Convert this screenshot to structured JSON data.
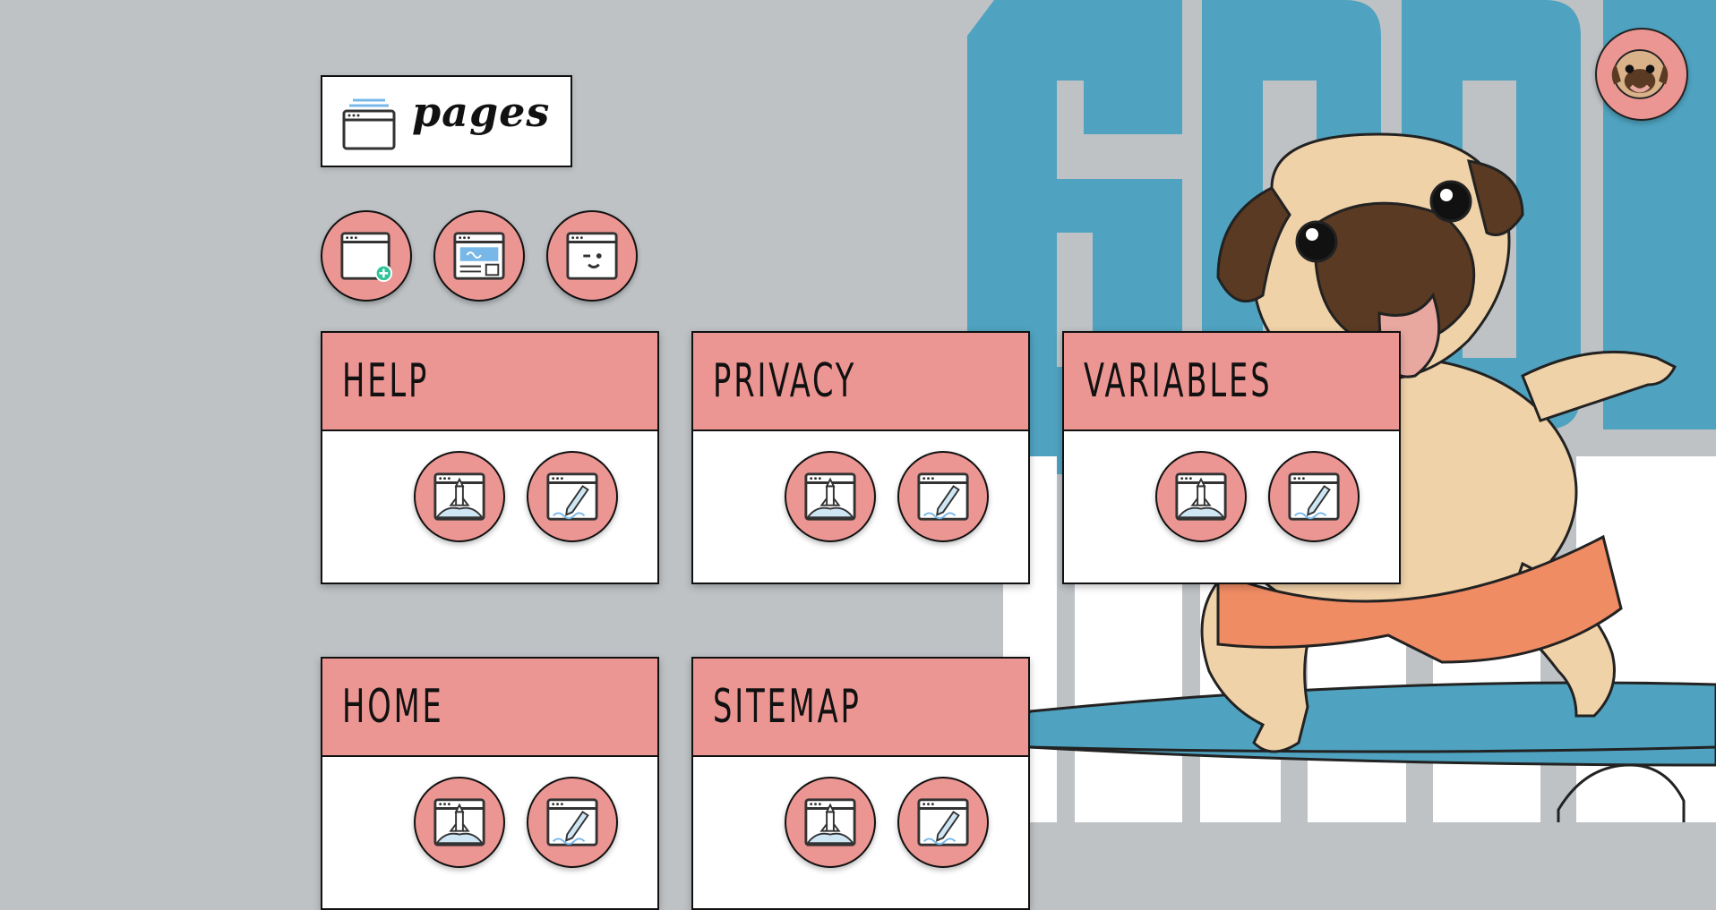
{
  "header": {
    "title": "pages",
    "icon": "browser-window-icon"
  },
  "avatar": {
    "icon": "pug-avatar-icon"
  },
  "toolbar": {
    "buttons": [
      {
        "name": "add-page-button",
        "icon": "browser-add-icon"
      },
      {
        "name": "page-layout-button",
        "icon": "browser-layout-icon"
      },
      {
        "name": "page-wink-button",
        "icon": "browser-wink-icon"
      }
    ]
  },
  "cards": [
    {
      "title": "HELP"
    },
    {
      "title": "PRIVACY"
    },
    {
      "title": "VARIABLES"
    },
    {
      "title": "HOME"
    },
    {
      "title": "SITEMAP"
    }
  ],
  "card_actions": {
    "deploy_icon": "rocket-launch-icon",
    "edit_icon": "pen-edit-icon"
  },
  "background": {
    "text": "GOOD TIMES",
    "colors": {
      "accent": "#ec9693",
      "blue": "#4fa3c0",
      "bg": "#bec2c5"
    }
  }
}
